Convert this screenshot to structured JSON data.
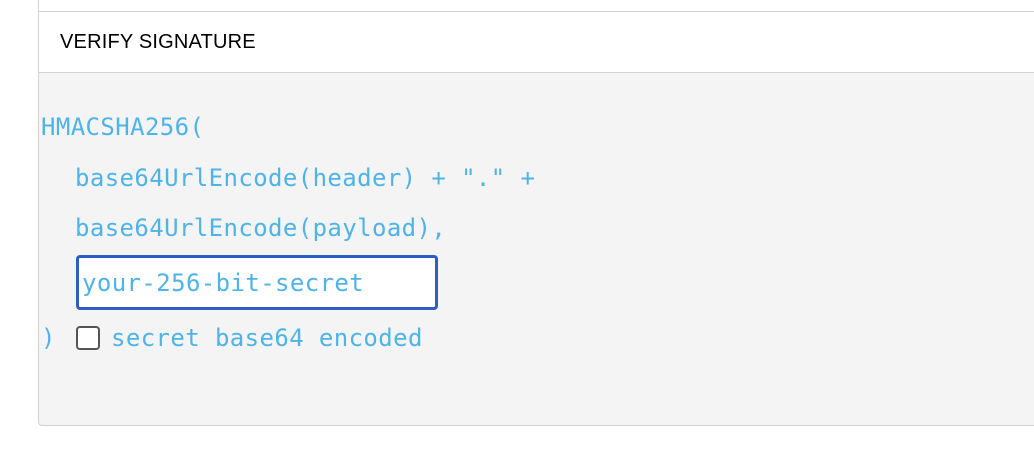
{
  "verify_signature": {
    "title": "VERIFY SIGNATURE",
    "code": {
      "line_1": "HMACSHA256(",
      "line_2": "base64UrlEncode(header) + \".\" +",
      "line_3": "base64UrlEncode(payload),",
      "close_paren": ")"
    },
    "secret_input": {
      "value": "your-256-bit-secret"
    },
    "base64_checkbox": {
      "label": "secret base64 encoded",
      "checked": false
    }
  },
  "colors": {
    "code_text": "#4fb3e6",
    "input_focus_border": "#2c5ec4",
    "panel_background": "#f4f4f4",
    "border": "#d2d2d2"
  }
}
